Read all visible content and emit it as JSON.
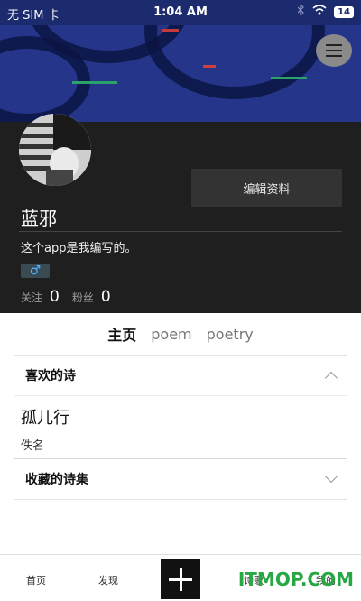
{
  "status_bar": {
    "carrier": "无 SIM 卡",
    "time": "1:04 AM",
    "battery": "14"
  },
  "profile": {
    "edit_label": "编辑资料",
    "username": "蓝邪",
    "bio": "这个app是我编写的。",
    "gender_symbol": "♂",
    "following_label": "关注",
    "following_count": "0",
    "followers_label": "粉丝",
    "followers_count": "0"
  },
  "tabs": [
    "主页",
    "poem",
    "poetry"
  ],
  "sections": {
    "liked_title": "喜欢的诗",
    "liked_items": [
      {
        "title": "孤儿行",
        "author": "佚名"
      }
    ],
    "collected_title": "收藏的诗集"
  },
  "bottom_nav": {
    "home": "首页",
    "discover": "发现",
    "poems": "诗歌",
    "mine": "我的"
  },
  "watermark": "ITMOP.COM",
  "colors": {
    "banner": "#25358a",
    "profile_bg": "#1f1f1f",
    "edit_button": "#333333",
    "gender_blue": "#4fb3ff"
  }
}
